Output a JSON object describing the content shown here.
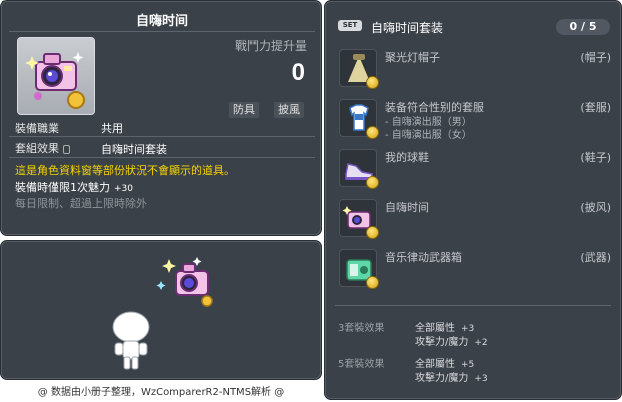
{
  "item_id": "01102876",
  "tooltip": {
    "title": "自嗨时间",
    "power_label": "戰鬥力提升量",
    "power_value": "0",
    "tags": [
      "防具",
      "披風"
    ],
    "job_label": "裝備職業",
    "job_value": "共用",
    "set_label": "套組效果",
    "set_value": "自嗨时间套装",
    "notice": "這是角色資料窗等部份狀況不會顯示的道具。",
    "charm_text": "裝備時僅限1次魅力",
    "charm_value": "+30",
    "limit_text": "每日限制、超過上限時除外"
  },
  "credit": "@ 数据由小册子整理，WzComparerR2-NTMS解析 @",
  "set_panel": {
    "badge": "SET",
    "name": "自嗨时间套装",
    "count": "0 / 5",
    "items": [
      {
        "name": "聚光灯帽子",
        "slot": "(帽子)",
        "icon": "spotlight-hat-icon"
      },
      {
        "name": "装备符合性别的套服",
        "slot": "(套服)",
        "icon": "outfit-icon",
        "sub": [
          "- 自嗨演出服（男）",
          "- 自嗨演出服（女）"
        ]
      },
      {
        "name": "我的球鞋",
        "slot": "(鞋子)",
        "icon": "sneaker-icon"
      },
      {
        "name": "自嗨时间",
        "slot": "(披风)",
        "icon": "camera-cape-icon"
      },
      {
        "name": "音乐律动武器箱",
        "slot": "(武器)",
        "icon": "weapon-box-icon"
      }
    ],
    "bonuses": [
      {
        "label": "3套裝效果",
        "lines": [
          {
            "text": "全部屬性",
            "num": "+3"
          },
          {
            "text": "攻擊力/魔力",
            "num": "+2"
          }
        ]
      },
      {
        "label": "5套裝效果",
        "lines": [
          {
            "text": "全部屬性",
            "num": "+5"
          },
          {
            "text": "攻擊力/魔力",
            "num": "+3"
          }
        ]
      }
    ]
  }
}
